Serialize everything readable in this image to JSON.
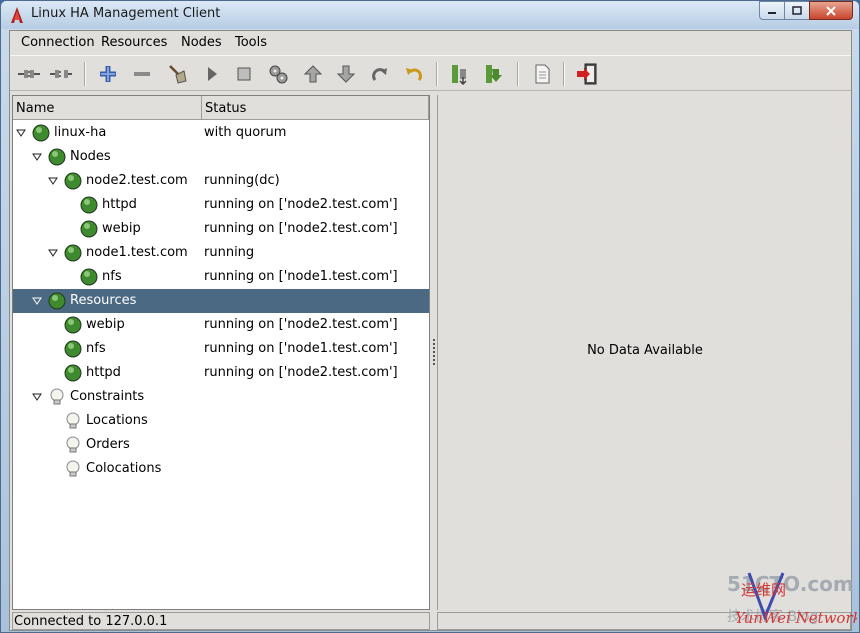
{
  "window": {
    "title": "Linux HA Management Client"
  },
  "menu": [
    "Connection",
    "Resources",
    "Nodes",
    "Tools"
  ],
  "toolbar": [
    "connect-icon",
    "disconnect-icon",
    "add-icon",
    "remove-icon",
    "cleanup-icon",
    "start-icon",
    "stop-icon",
    "default-icon",
    "move-up-icon",
    "move-down-icon",
    "redo-icon",
    "undo-icon",
    "node-standby-icon",
    "node-active-icon",
    "view-log-icon",
    "exit-icon"
  ],
  "columns": {
    "name": "Name",
    "status": "Status"
  },
  "tree": [
    {
      "label": "linux-ha",
      "status": "with quorum"
    },
    {
      "label": "Nodes",
      "status": ""
    },
    {
      "label": "node2.test.com",
      "status": "running(dc)"
    },
    {
      "label": "httpd",
      "status": "running on ['node2.test.com']"
    },
    {
      "label": "webip",
      "status": "running on ['node2.test.com']"
    },
    {
      "label": "node1.test.com",
      "status": "running"
    },
    {
      "label": "nfs",
      "status": "running on ['node1.test.com']"
    },
    {
      "label": "Resources",
      "status": ""
    },
    {
      "label": "webip",
      "status": "running on ['node2.test.com']"
    },
    {
      "label": "nfs",
      "status": "running on ['node1.test.com']"
    },
    {
      "label": "httpd",
      "status": "running on ['node2.test.com']"
    },
    {
      "label": "Constraints",
      "status": ""
    },
    {
      "label": "Locations",
      "status": ""
    },
    {
      "label": "Orders",
      "status": ""
    },
    {
      "label": "Colocations",
      "status": ""
    }
  ],
  "detail": {
    "message": "No Data Available"
  },
  "statusbar": {
    "text": "Connected to 127.0.0.1"
  },
  "watermark": {
    "line1": "51CTO.com",
    "line2": "技术博客 Blog",
    "line3": "运维网",
    "line4": "YunWei Network"
  },
  "colors": {
    "selection": "#4b6983",
    "status_icon": "#3f8a2f",
    "panel_bg": "#e0dfdb"
  }
}
